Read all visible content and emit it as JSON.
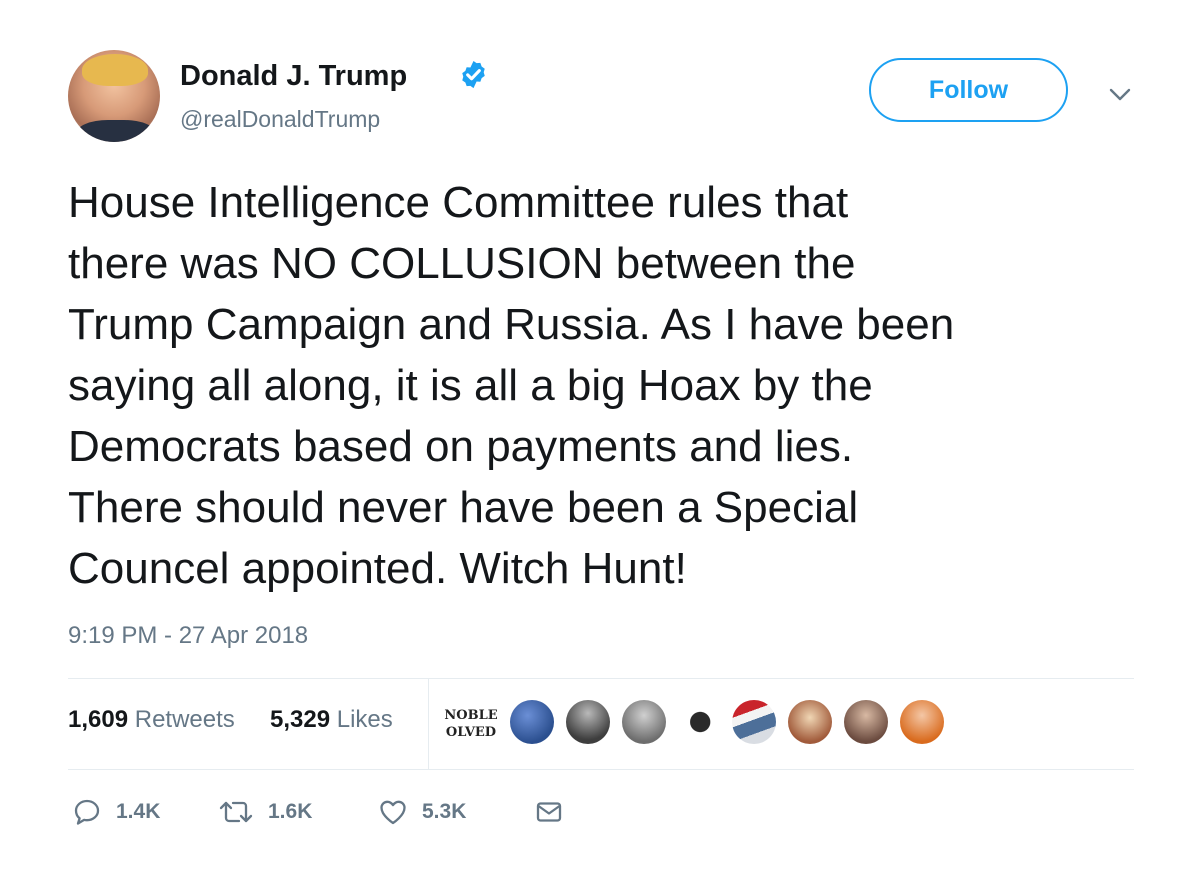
{
  "author": {
    "display_name": "Donald J. Trump",
    "handle": "@realDonaldTrump",
    "verified": true,
    "avatar": "profile-photo"
  },
  "header": {
    "follow_label": "Follow",
    "menu_icon": "chevron-down-icon"
  },
  "tweet": {
    "text_lines": [
      "House Intelligence Committee rules that",
      "there was NO COLLUSION between the",
      "Trump Campaign and Russia. As I have been",
      "saying all along, it is all a big Hoax by the",
      "Democrats based on payments and lies.",
      "There should never have been a Special",
      "Councel appointed. Witch Hunt!"
    ],
    "timestamp": "9:19 PM - 27 Apr 2018"
  },
  "stats": {
    "retweets_count": "1,609",
    "retweets_label": "Retweets",
    "likes_count": "5,329",
    "likes_label": "Likes",
    "liker_avatars": [
      {
        "icon": "liker-text-avatar",
        "text": "NOBLE DISSOLVED"
      },
      {
        "icon": "liker-avatar"
      },
      {
        "icon": "liker-avatar"
      },
      {
        "icon": "liker-avatar"
      },
      {
        "icon": "liker-avatar"
      },
      {
        "icon": "liker-avatar"
      },
      {
        "icon": "liker-avatar"
      },
      {
        "icon": "liker-avatar"
      },
      {
        "icon": "liker-avatar"
      }
    ]
  },
  "actions": {
    "reply_count": "1.4K",
    "retweet_count": "1.6K",
    "like_count": "5.3K",
    "icons": [
      "reply-icon",
      "retweet-icon",
      "heart-icon",
      "message-icon"
    ]
  },
  "colors": {
    "accent": "#1da1f2",
    "text_primary": "#14171a",
    "text_secondary": "#657786",
    "divider": "#e6ecf0"
  }
}
